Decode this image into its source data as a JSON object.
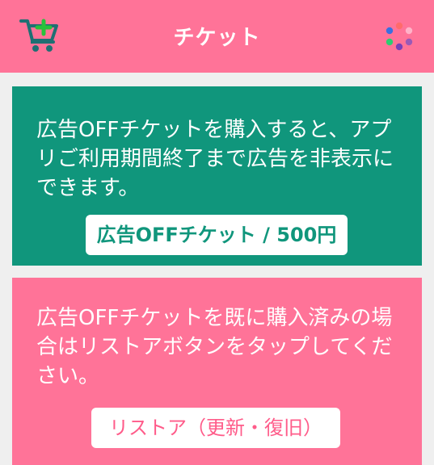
{
  "colors": {
    "accent": "#ff7398",
    "teal": "#10967c",
    "background": "#efefef"
  },
  "header": {
    "title": "チケット",
    "left_icon": "cart-icon",
    "right_icon": "dots-icon"
  },
  "ad_off_card": {
    "description": "広告OFFチケットを購入すると、アプリご利用期間終了まで広告を非表示にできます。",
    "button_label": "広告OFFチケット / 500円"
  },
  "restore_card": {
    "description": "広告OFFチケットを既に購入済みの場合はリストアボタンをタップしてください。",
    "button_label": "リストア（更新・復旧）"
  }
}
